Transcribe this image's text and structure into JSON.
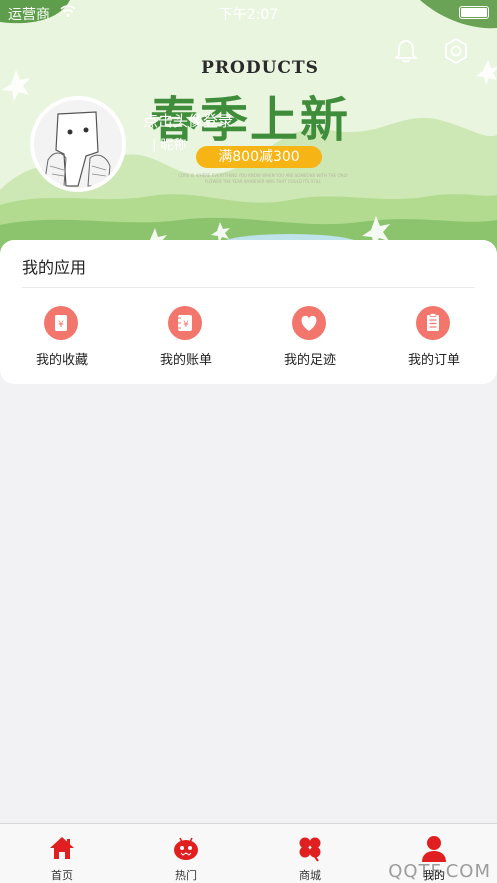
{
  "status_bar": {
    "carrier": "运营商",
    "time": "下午2:07"
  },
  "banner": {
    "products_text": "PRODUCTS",
    "headline": "春季上新",
    "promo": "满800减300",
    "fine_print": "CORE IS WHERE EVERYTHING YOU KNOW WHEN YOU ARE SOMEONE WITH THE ONLY FLOWER THE YEAR WHOEVER WAS THAT COULD ITS STILL",
    "colors": {
      "green_dark": "#3f8d3b",
      "promo_yellow": "#f6b514",
      "sky": "#eaf5df"
    }
  },
  "profile": {
    "login_text": "点击头像登录",
    "sub_text": "| 昵称"
  },
  "header_icons": {
    "bell": "bell-icon",
    "settings": "gear-icon"
  },
  "my_apps": {
    "title": "我的应用",
    "items": [
      {
        "label": "我的收藏",
        "icon": "favorites-icon"
      },
      {
        "label": "我的账单",
        "icon": "bill-icon"
      },
      {
        "label": "我的足迹",
        "icon": "heart-footprint-icon"
      },
      {
        "label": "我的订单",
        "icon": "clipboard-icon"
      }
    ],
    "icon_color": "#f2766b"
  },
  "tab_bar": {
    "items": [
      {
        "label": "首页",
        "icon": "home-icon"
      },
      {
        "label": "热门",
        "icon": "android-icon"
      },
      {
        "label": "商城",
        "icon": "clover-icon"
      },
      {
        "label": "我的",
        "icon": "user-icon",
        "active": true
      }
    ],
    "accent": "#e02020"
  },
  "watermark": "QQTF.COM"
}
